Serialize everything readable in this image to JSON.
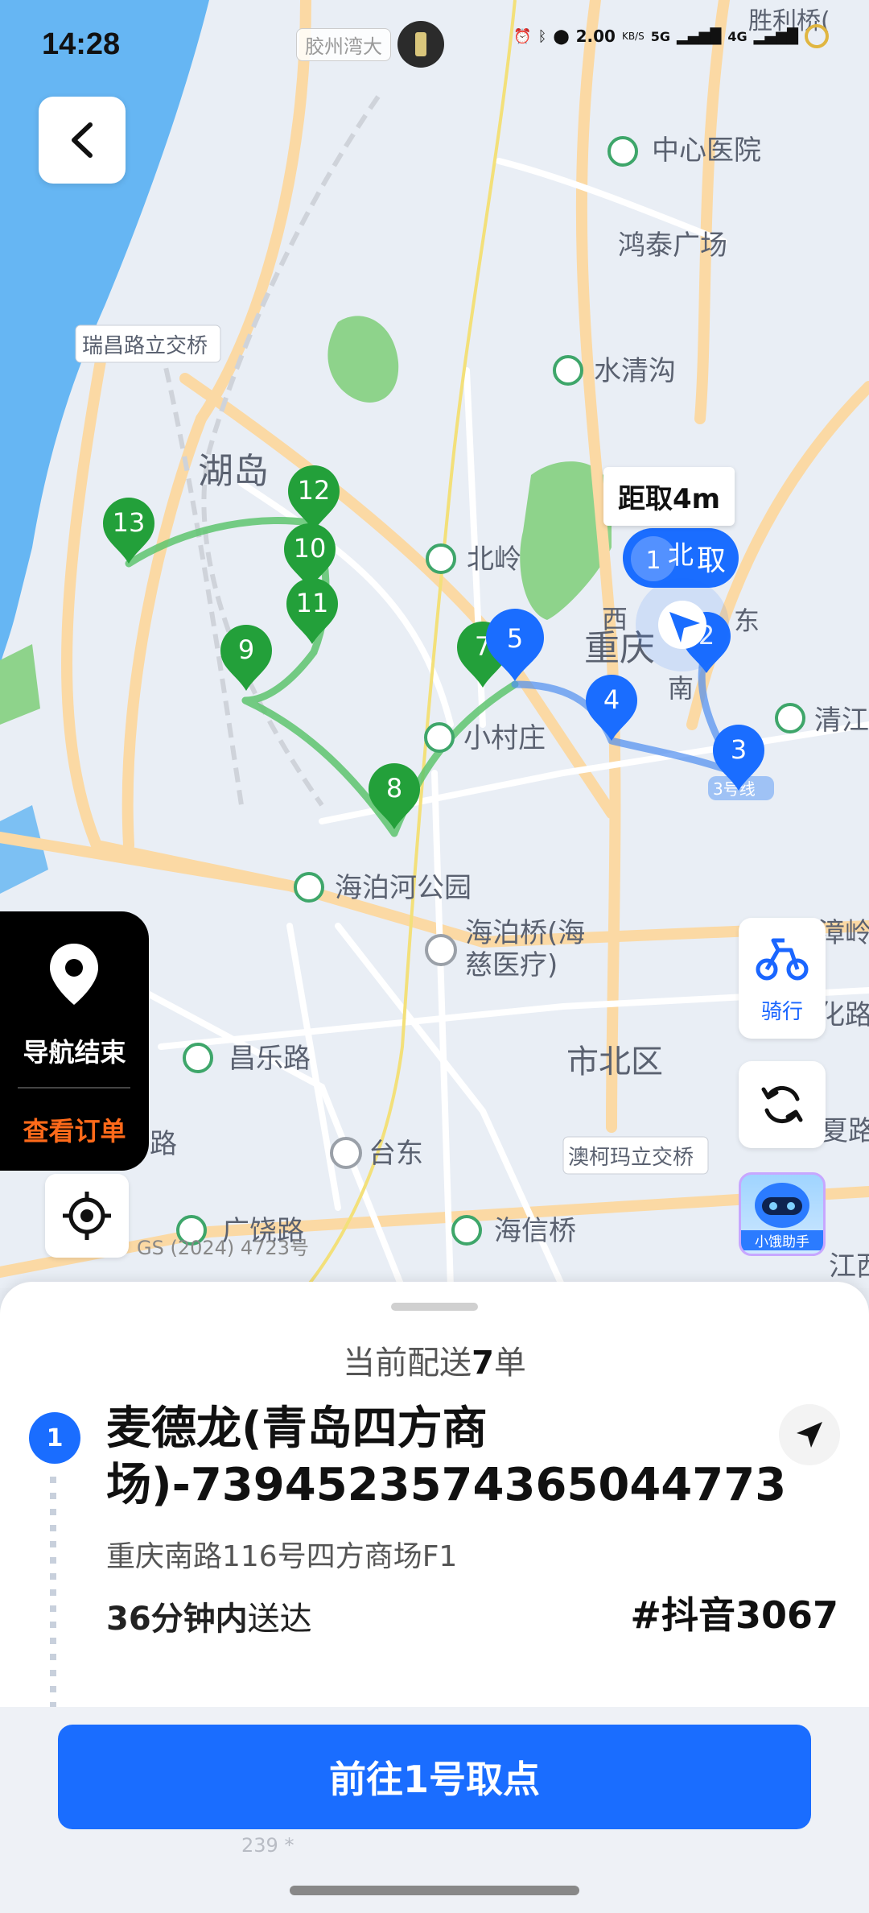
{
  "status_bar": {
    "time": "14:28",
    "center_label": "胶州湾大",
    "network_speed": "2.00",
    "network_unit": "KB/S",
    "sig1": "5G",
    "sig2": "4G"
  },
  "map": {
    "labels": {
      "zhongxin_hospital": "中心医院",
      "hongtai_plaza": "鸿泰广场",
      "ruichang_bridge": "瑞昌路立交桥",
      "shuiqinggou": "水清沟",
      "hudao": "湖岛",
      "beiling": "北岭",
      "chongqing": "重庆",
      "xiaocunzhuang": "小村庄",
      "qingjiang": "清江",
      "haibohe_park": "海泊河公园",
      "haibo_bridge": "海泊桥(海",
      "haibo_bridge2": "慈医疗)",
      "changle_road": "昌乐路",
      "shibei_district": "市北区",
      "taidong": "台东",
      "aokema_bridge": "澳柯玛立交桥",
      "haixin_bridge": "海信桥",
      "guangrao_road": "广饶路",
      "zhangling": "漳岭",
      "huaroad": "化路",
      "xia": "夏路",
      "jiangxi": "江西",
      "shengli_bridge": "胜利桥(",
      "line3": "3号线",
      "lu": "路",
      "west": "西",
      "east": "东",
      "south": "南"
    },
    "distance_label": "距取4m",
    "pickup_badge_text": "北",
    "pickup_badge_text2": "取",
    "markers_green": [
      "7",
      "8",
      "9",
      "10",
      "11",
      "12",
      "13"
    ],
    "markers_blue": [
      "1",
      "2",
      "3",
      "4",
      "5"
    ],
    "copyright": "GS (2024) 4723号"
  },
  "side_panel": {
    "nav_end": "导航结束",
    "view_order": "查看订单"
  },
  "right_controls": {
    "ride_label": "骑行",
    "assistant_label": "小饿助手"
  },
  "colors": {
    "accent_blue": "#1a6dff",
    "route_green": "#5ec46e",
    "marker_green": "#23a03a",
    "orange": "#ff6a1a"
  },
  "sheet": {
    "count_prefix": "当前配送",
    "count_value": "7",
    "count_suffix": "单",
    "order": {
      "index": "1",
      "store_name": "麦德龙(青岛四方商场)-739452357436504477 3",
      "address": "重庆南路116号四方商场F1",
      "deadline_strong": "36分钟内",
      "deadline_rest": "送达",
      "platform_tag": "#抖音3067"
    },
    "cta": "前往1号取点",
    "ghost_text": "239 *"
  }
}
